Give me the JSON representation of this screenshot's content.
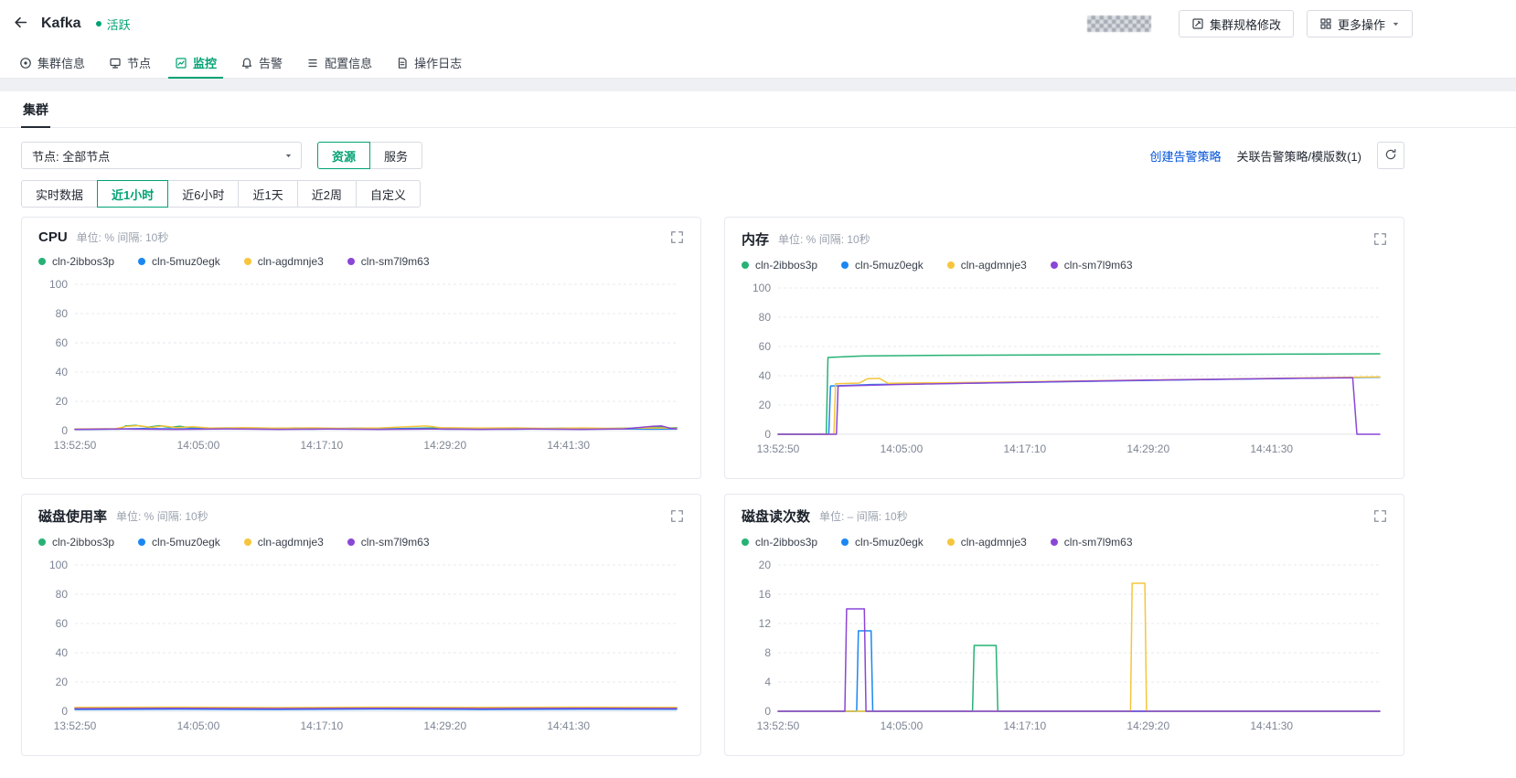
{
  "header": {
    "title": "Kafka",
    "status": "活跃",
    "spec_button": "集群规格修改",
    "more_button": "更多操作"
  },
  "tabs": [
    {
      "id": "cluster-info",
      "label": "集群信息",
      "icon": "cluster-info-icon",
      "active": false
    },
    {
      "id": "nodes",
      "label": "节点",
      "icon": "node-icon",
      "active": false
    },
    {
      "id": "monitor",
      "label": "监控",
      "icon": "monitor-icon",
      "active": true
    },
    {
      "id": "alarm",
      "label": "告警",
      "icon": "alarm-icon",
      "active": false
    },
    {
      "id": "config-info",
      "label": "配置信息",
      "icon": "config-icon",
      "active": false
    },
    {
      "id": "operation-log",
      "label": "操作日志",
      "icon": "log-icon",
      "active": false
    }
  ],
  "subtab": "集群",
  "filters": {
    "node_select": "节点: 全部节点",
    "view_toggle": [
      {
        "label": "资源",
        "active": true
      },
      {
        "label": "服务",
        "active": false
      }
    ],
    "create_alert_link": "创建告警策略",
    "assoc_alert_text": "关联告警策略/模版数(1)"
  },
  "time_ranges": [
    {
      "label": "实时数据",
      "active": false
    },
    {
      "label": "近1小时",
      "active": true
    },
    {
      "label": "近6小时",
      "active": false
    },
    {
      "label": "近1天",
      "active": false
    },
    {
      "label": "近2周",
      "active": false
    },
    {
      "label": "自定义",
      "active": false
    }
  ],
  "colors": {
    "accent_green": "#00a273",
    "link_blue": "#0052d9",
    "series_green": "#27b275",
    "series_blue": "#1b87f2",
    "series_yellow": "#f6c53c",
    "series_purple": "#8a46d6"
  },
  "chart_data": [
    {
      "type": "line",
      "title": "CPU",
      "subtitle": "单位: % 间隔: 10秒",
      "ylim": [
        0,
        100
      ],
      "yticks": [
        0,
        20,
        40,
        60,
        80,
        100
      ],
      "xticks": [
        "13:52:50",
        "14:05:00",
        "14:17:10",
        "14:29:20",
        "14:41:30"
      ],
      "xtick_t": [
        0,
        730,
        1460,
        2190,
        2920
      ],
      "x_max": 3560,
      "grid": true,
      "legend_position": "top",
      "series": [
        {
          "name": "cln-2ibbos3p",
          "color": "#27b275",
          "points": [
            [
              0,
              1
            ],
            [
              180,
              1.2
            ],
            [
              260,
              1
            ],
            [
              300,
              3.2
            ],
            [
              360,
              3.6
            ],
            [
              430,
              2.4
            ],
            [
              500,
              3.4
            ],
            [
              560,
              2.2
            ],
            [
              620,
              3
            ],
            [
              700,
              1.6
            ],
            [
              900,
              1.8
            ],
            [
              1100,
              1.4
            ],
            [
              1300,
              1.8
            ],
            [
              1500,
              1.3
            ],
            [
              1700,
              1.7
            ],
            [
              1900,
              1.3
            ],
            [
              2100,
              1.8
            ],
            [
              2300,
              1.4
            ],
            [
              2500,
              1.7
            ],
            [
              2700,
              1.3
            ],
            [
              2900,
              1.6
            ],
            [
              3100,
              1.3
            ],
            [
              3300,
              1.7
            ],
            [
              3440,
              2.6
            ],
            [
              3520,
              1.8
            ],
            [
              3560,
              2
            ]
          ]
        },
        {
          "name": "cln-5muz0egk",
          "color": "#1b87f2",
          "points": [
            [
              0,
              0.8
            ],
            [
              200,
              1
            ],
            [
              400,
              1.4
            ],
            [
              600,
              1.2
            ],
            [
              800,
              1.5
            ],
            [
              1000,
              1.1
            ],
            [
              1200,
              1.4
            ],
            [
              1400,
              1
            ],
            [
              1600,
              1.3
            ],
            [
              1800,
              1
            ],
            [
              2000,
              1.3
            ],
            [
              2200,
              1
            ],
            [
              2400,
              1.2
            ],
            [
              2600,
              1
            ],
            [
              2800,
              1.2
            ],
            [
              3000,
              1
            ],
            [
              3200,
              1.2
            ],
            [
              3400,
              1
            ],
            [
              3560,
              1.1
            ]
          ]
        },
        {
          "name": "cln-agdmnje3",
          "color": "#f6c53c",
          "points": [
            [
              0,
              1.1
            ],
            [
              240,
              1.3
            ],
            [
              310,
              3
            ],
            [
              380,
              3.4
            ],
            [
              450,
              2.2
            ],
            [
              520,
              3.2
            ],
            [
              600,
              2
            ],
            [
              700,
              2.6
            ],
            [
              800,
              1.7
            ],
            [
              1000,
              2
            ],
            [
              1200,
              1.6
            ],
            [
              1400,
              1.9
            ],
            [
              1600,
              1.5
            ],
            [
              1800,
              1.8
            ],
            [
              2000,
              2.8
            ],
            [
              2080,
              3.2
            ],
            [
              2160,
              2
            ],
            [
              2400,
              1.7
            ],
            [
              2600,
              1.9
            ],
            [
              2800,
              1.5
            ],
            [
              3000,
              1.8
            ],
            [
              3200,
              1.5
            ],
            [
              3400,
              1.8
            ],
            [
              3560,
              1.6
            ]
          ]
        },
        {
          "name": "cln-sm7l9m63",
          "color": "#8a46d6",
          "points": [
            [
              0,
              0.9
            ],
            [
              300,
              1.1
            ],
            [
              600,
              0.9
            ],
            [
              900,
              1.2
            ],
            [
              1200,
              0.9
            ],
            [
              1500,
              1.1
            ],
            [
              1800,
              0.9
            ],
            [
              2100,
              1.1
            ],
            [
              2400,
              0.9
            ],
            [
              2700,
              1.1
            ],
            [
              3000,
              0.9
            ],
            [
              3250,
              1.2
            ],
            [
              3420,
              3
            ],
            [
              3470,
              3.2
            ],
            [
              3530,
              1.4
            ],
            [
              3560,
              1.2
            ]
          ]
        }
      ]
    },
    {
      "type": "line",
      "title": "内存",
      "subtitle": "单位: % 间隔: 10秒",
      "ylim": [
        0,
        100
      ],
      "yticks": [
        0,
        20,
        40,
        60,
        80,
        100
      ],
      "xticks": [
        "13:52:50",
        "14:05:00",
        "14:17:10",
        "14:29:20",
        "14:41:30"
      ],
      "xtick_t": [
        0,
        730,
        1460,
        2190,
        2920
      ],
      "x_max": 3560,
      "grid": true,
      "legend_position": "top",
      "series": [
        {
          "name": "cln-2ibbos3p",
          "color": "#27b275",
          "points": [
            [
              0,
              0
            ],
            [
              285,
              0
            ],
            [
              295,
              52.5
            ],
            [
              500,
              53.5
            ],
            [
              1000,
              54
            ],
            [
              1800,
              54.3
            ],
            [
              2600,
              54.6
            ],
            [
              3200,
              54.8
            ],
            [
              3560,
              55
            ]
          ]
        },
        {
          "name": "cln-5muz0egk",
          "color": "#1b87f2",
          "points": [
            [
              0,
              0
            ],
            [
              300,
              0
            ],
            [
              310,
              33
            ],
            [
              550,
              34
            ],
            [
              1200,
              35
            ],
            [
              2000,
              36.5
            ],
            [
              2800,
              37.8
            ],
            [
              3300,
              38.6
            ],
            [
              3560,
              39
            ]
          ]
        },
        {
          "name": "cln-agdmnje3",
          "color": "#f6c53c",
          "points": [
            [
              0,
              0
            ],
            [
              330,
              0
            ],
            [
              340,
              34.5
            ],
            [
              480,
              35
            ],
            [
              530,
              38
            ],
            [
              600,
              38.2
            ],
            [
              650,
              34.8
            ],
            [
              1200,
              35.5
            ],
            [
              2000,
              36.8
            ],
            [
              2800,
              38
            ],
            [
              3300,
              38.8
            ],
            [
              3560,
              39.2
            ]
          ]
        },
        {
          "name": "cln-sm7l9m63",
          "color": "#8a46d6",
          "points": [
            [
              0,
              0
            ],
            [
              345,
              0
            ],
            [
              355,
              33
            ],
            [
              700,
              34
            ],
            [
              1400,
              35.5
            ],
            [
              2200,
              37
            ],
            [
              3000,
              38.2
            ],
            [
              3380,
              38.6
            ],
            [
              3400,
              38.6
            ],
            [
              3425,
              0
            ],
            [
              3560,
              0
            ]
          ]
        }
      ]
    },
    {
      "type": "line",
      "title": "磁盘使用率",
      "subtitle": "单位: % 间隔: 10秒",
      "ylim": [
        0,
        100
      ],
      "yticks": [
        0,
        20,
        40,
        60,
        80,
        100
      ],
      "xticks": [
        "13:52:50",
        "14:05:00",
        "14:17:10",
        "14:29:20",
        "14:41:30"
      ],
      "xtick_t": [
        0,
        730,
        1460,
        2190,
        2920
      ],
      "x_max": 3560,
      "grid": true,
      "legend_position": "top",
      "series": [
        {
          "name": "cln-2ibbos3p",
          "color": "#27b275",
          "points": [
            [
              0,
              2
            ],
            [
              500,
              2.2
            ],
            [
              1000,
              2
            ],
            [
              1500,
              2.3
            ],
            [
              2000,
              2
            ],
            [
              2500,
              2.2
            ],
            [
              3000,
              2
            ],
            [
              3560,
              2.1
            ]
          ]
        },
        {
          "name": "cln-5muz0egk",
          "color": "#1b87f2",
          "points": [
            [
              0,
              1.2
            ],
            [
              600,
              1.4
            ],
            [
              1200,
              1.2
            ],
            [
              1800,
              1.5
            ],
            [
              2400,
              1.2
            ],
            [
              3000,
              1.4
            ],
            [
              3560,
              1.3
            ]
          ]
        },
        {
          "name": "cln-agdmnje3",
          "color": "#f6c53c",
          "points": [
            [
              0,
              2.6
            ],
            [
              600,
              2.8
            ],
            [
              1200,
              2.5
            ],
            [
              1800,
              2.8
            ],
            [
              2400,
              2.6
            ],
            [
              3000,
              2.8
            ],
            [
              3560,
              2.7
            ]
          ]
        },
        {
          "name": "cln-sm7l9m63",
          "color": "#8a46d6",
          "points": [
            [
              0,
              1.8
            ],
            [
              600,
              2
            ],
            [
              1200,
              1.8
            ],
            [
              1800,
              2
            ],
            [
              2400,
              1.8
            ],
            [
              3000,
              2
            ],
            [
              3560,
              1.9
            ]
          ]
        }
      ]
    },
    {
      "type": "line",
      "title": "磁盘读次数",
      "subtitle": "单位: – 间隔: 10秒",
      "ylim": [
        0,
        20
      ],
      "yticks": [
        0,
        4,
        8,
        12,
        16,
        20
      ],
      "xticks": [
        "13:52:50",
        "14:05:00",
        "14:17:10",
        "14:29:20",
        "14:41:30"
      ],
      "xtick_t": [
        0,
        730,
        1460,
        2190,
        2920
      ],
      "x_max": 3560,
      "grid": true,
      "legend_position": "top",
      "series": [
        {
          "name": "cln-2ibbos3p",
          "color": "#27b275",
          "points": [
            [
              0,
              0
            ],
            [
              1150,
              0
            ],
            [
              1160,
              9
            ],
            [
              1290,
              9
            ],
            [
              1300,
              0
            ],
            [
              3560,
              0
            ]
          ]
        },
        {
          "name": "cln-5muz0egk",
          "color": "#1b87f2",
          "points": [
            [
              0,
              0
            ],
            [
              465,
              0
            ],
            [
              475,
              11
            ],
            [
              550,
              11
            ],
            [
              560,
              0
            ],
            [
              3560,
              0
            ]
          ]
        },
        {
          "name": "cln-agdmnje3",
          "color": "#f6c53c",
          "points": [
            [
              0,
              0
            ],
            [
              2085,
              0
            ],
            [
              2095,
              17.5
            ],
            [
              2170,
              17.5
            ],
            [
              2180,
              0
            ],
            [
              3560,
              0
            ]
          ]
        },
        {
          "name": "cln-sm7l9m63",
          "color": "#8a46d6",
          "points": [
            [
              0,
              0
            ],
            [
              395,
              0
            ],
            [
              405,
              14
            ],
            [
              510,
              14
            ],
            [
              520,
              0
            ],
            [
              3560,
              0
            ]
          ]
        }
      ]
    }
  ]
}
